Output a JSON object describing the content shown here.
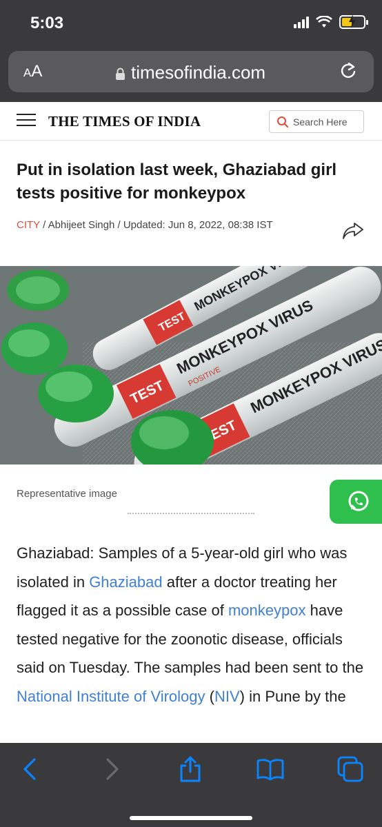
{
  "status_bar": {
    "time": "5:03"
  },
  "browser": {
    "aa_label_small": "A",
    "aa_label_big": "A",
    "url": "timesofindia.com"
  },
  "site_header": {
    "logo": "THE TIMES OF INDIA",
    "search_placeholder": "Search Here"
  },
  "article": {
    "headline": "Put in isolation last week, Ghaziabad girl tests positive for monkeypox",
    "category": "CITY",
    "byline_rest": " / Abhijeet Singh / Updated: Jun 8, 2022, 08:38 IST",
    "image_caption": "Representative image",
    "image_labels": [
      "MONKEYPOX VIRUS",
      "TEST",
      "POSITIVE"
    ],
    "body": {
      "p1": "Ghaziabad: Samples of a 5-year-old girl who was isolated in ",
      "link1": "Ghaziabad",
      "p2": " after a doctor treating her flagged it as a possible case of ",
      "link2": "monkeypox",
      "p3": " have tested negative for the zoonotic disease, officials said on Tuesday. The samples had been sent to the ",
      "link3": "National Institute of Virology",
      "p4": " (",
      "link4": "NIV",
      "p5": ") in Pune by the"
    }
  },
  "colors": {
    "accent_link": "#3f7fd5",
    "city_tag": "#e04b3c",
    "whatsapp": "#2fbf4c",
    "browser_chrome": "#3a3a3c",
    "toolbar_icon": "#0a84ff"
  },
  "icons": [
    "hamburger-icon",
    "search-icon",
    "share-icon",
    "whatsapp-icon",
    "lock-icon",
    "reload-icon",
    "back-icon",
    "forward-icon",
    "share-sheet-icon",
    "bookmarks-icon",
    "tabs-icon"
  ]
}
